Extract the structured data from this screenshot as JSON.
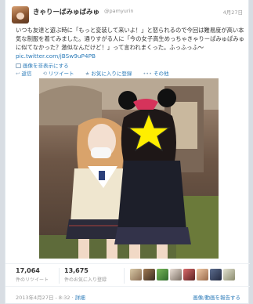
{
  "tweet": {
    "display_name": "きゃりーぱみゅぱみゅ",
    "screen_name": "@pamyurin",
    "date": "4月27日",
    "text": "いつも友達と遊ぶ時に「もっと変装して来いよ！」と怒られるので今回は難易度が高い本気な制服を着てみました。通りすがる人に「今の女子高生めっちゃきゃりーぱみゅぱみゅに似てなかった？激似なんだけど！」って言われまくった。ふっふっふ〜",
    "link": "pic.twitter.com/jBSw9uP4PB",
    "hide_media": "画像を非表示にする",
    "actions": {
      "reply": "返信",
      "retweet": "リツイート",
      "favorite": "お気に入りに登録",
      "more": "その他"
    },
    "retweets": {
      "count": "17,064",
      "label": "件のリツイート"
    },
    "favorites": {
      "count": "13,675",
      "label": "件のお気に入り登録"
    },
    "timestamp": "2013年4月27日 - 8:32",
    "detail": "詳細",
    "report": "画像/動画を報告する"
  },
  "icons": {
    "reply": "↩",
    "retweet": "⟲",
    "favorite": "★",
    "more": "•••"
  },
  "colors": {
    "link": "#2b7bb9",
    "star": "#ffee00"
  }
}
